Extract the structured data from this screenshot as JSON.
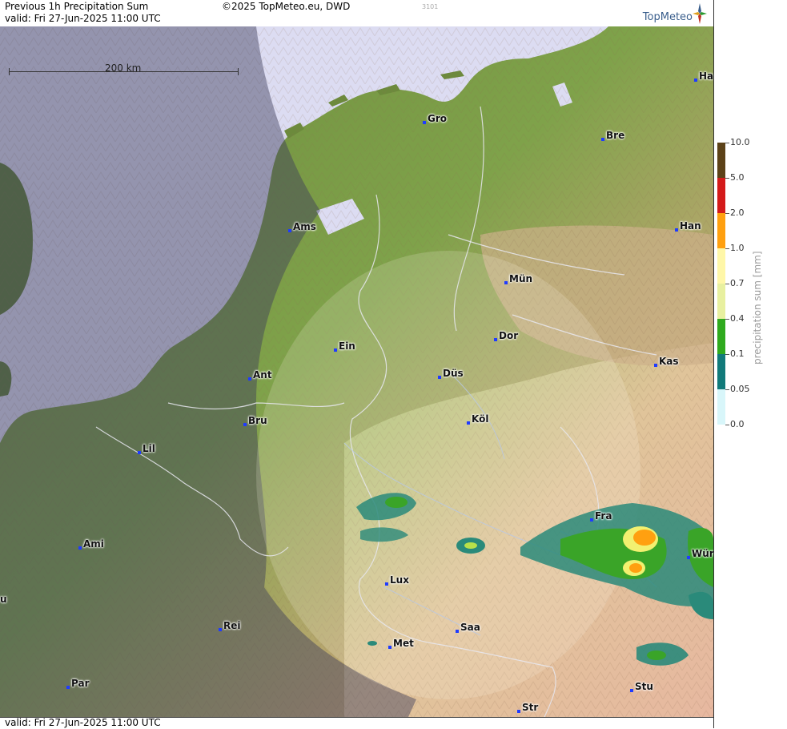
{
  "header": {
    "title": "Previous 1h Precipitation Sum",
    "valid": "valid:  Fri  27-Jun-2025 11:00 UTC",
    "copyright": "©2025 TopMeteo.eu, DWD",
    "code": "3101",
    "logo": "TopMeteo"
  },
  "footer": {
    "valid": "valid:  Fri  27-Jun-2025 11:00 UTC"
  },
  "scale": {
    "label": "200 km"
  },
  "cities": [
    {
      "name": "Ha"
    },
    {
      "name": "Gro"
    },
    {
      "name": "Bre"
    },
    {
      "name": "Ams"
    },
    {
      "name": "Han"
    },
    {
      "name": "Mün"
    },
    {
      "name": "Dor"
    },
    {
      "name": "Ein"
    },
    {
      "name": "Kas"
    },
    {
      "name": "Ant"
    },
    {
      "name": "Düs"
    },
    {
      "name": "Bru"
    },
    {
      "name": "Köl"
    },
    {
      "name": "Lil"
    },
    {
      "name": "Fra"
    },
    {
      "name": "Ami"
    },
    {
      "name": "Wür"
    },
    {
      "name": "Lux"
    },
    {
      "name": "u"
    },
    {
      "name": "Rei"
    },
    {
      "name": "Saa"
    },
    {
      "name": "Met"
    },
    {
      "name": "Par"
    },
    {
      "name": "Stu"
    },
    {
      "name": "Str"
    }
  ],
  "legend": {
    "title": "precipitation sum [mm]",
    "levels": [
      {
        "label": "10.0",
        "color": "#5c4218"
      },
      {
        "label": "5.0",
        "color": "#d41a1a"
      },
      {
        "label": "2.0",
        "color": "#ffa010"
      },
      {
        "label": "1.0",
        "color": "#fff7a8"
      },
      {
        "label": "0.7",
        "color": "#e8f0a0"
      },
      {
        "label": "0.4",
        "color": "#2faa1e"
      },
      {
        "label": "0.1",
        "color": "#127a7a"
      },
      {
        "label": "0.05",
        "color": "#d8f6fa"
      },
      {
        "label": "0.0",
        "color": "#ffffff"
      }
    ]
  }
}
